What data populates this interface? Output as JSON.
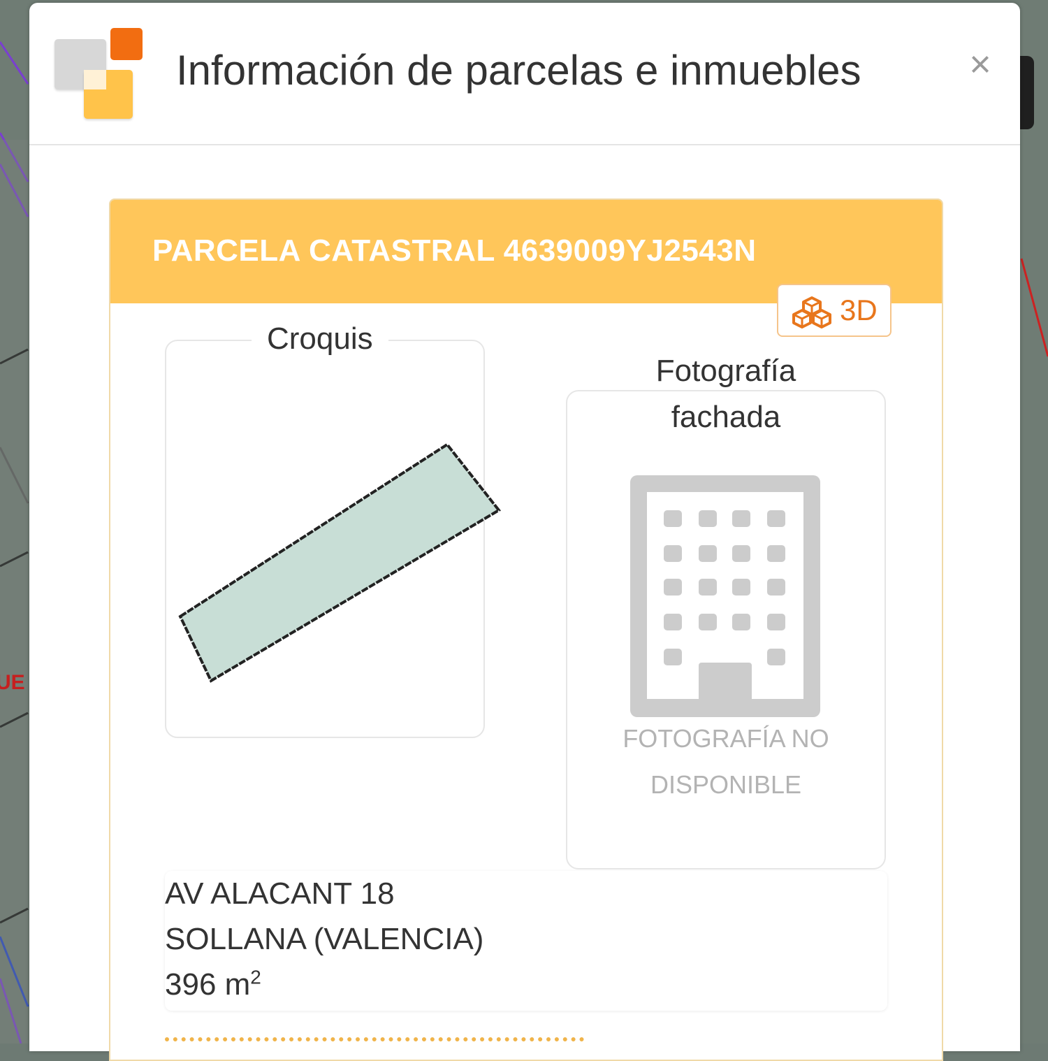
{
  "modal": {
    "title": "Información de parcelas e inmuebles",
    "close_label": "×"
  },
  "parcel": {
    "header": "PARCELA CATASTRAL 4639009YJ2543N",
    "btn_3d_label": "3D",
    "croquis_label": "Croquis",
    "foto_label_line1": "Fotografía",
    "foto_label_line2": "fachada",
    "no_photo_line1": "FOTOGRAFÍA NO",
    "no_photo_line2": "DISPONIBLE",
    "address_line1": "AV ALACANT 18",
    "address_line2": "SOLLANA (VALENCIA)",
    "area_value": "396 m",
    "area_exp": "2"
  },
  "map": {
    "label_fragment": "UE"
  },
  "colors": {
    "accent_orange": "#f26d11",
    "header_yellow": "#ffc65a",
    "parcel_fill": "#c8ded6",
    "building_gray": "#cccccc"
  }
}
